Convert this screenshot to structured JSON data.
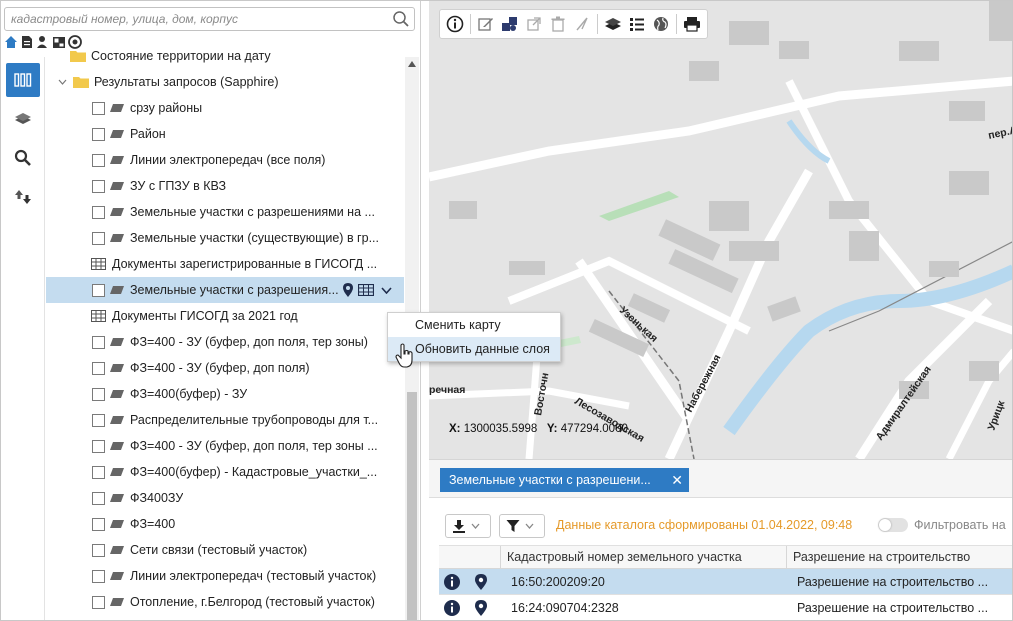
{
  "search": {
    "placeholder": "кадастровый номер, улица, дом, корпус"
  },
  "tree": {
    "partial_top": "Состояние территории на дату",
    "group": "Результаты запросов (Sapphire)",
    "items": [
      {
        "label": "срзу районы",
        "kind": "layer"
      },
      {
        "label": "Район",
        "kind": "layer"
      },
      {
        "label": "Линии электропередач (все поля)",
        "kind": "layer"
      },
      {
        "label": "ЗУ с ГПЗУ в КВЗ",
        "kind": "layer"
      },
      {
        "label": "Земельные участки с разрешениями на ...",
        "kind": "layer"
      },
      {
        "label": "Земельные участки (существующие) в гр...",
        "kind": "layer"
      },
      {
        "label": "Документы зарегистрированные в ГИСОГД ...",
        "kind": "table"
      },
      {
        "label": "Земельные участки с разрешения...",
        "kind": "layer",
        "selected": true
      },
      {
        "label": "Документы ГИСОГД за 2021 год",
        "kind": "table"
      },
      {
        "label": "ФЗ=400 - ЗУ (буфер, доп поля, тер зоны)",
        "kind": "layer"
      },
      {
        "label": "ФЗ=400 - ЗУ (буфер, доп поля)",
        "kind": "layer"
      },
      {
        "label": "ФЗ=400(буфер) - ЗУ",
        "kind": "layer"
      },
      {
        "label": "Распределительные трубопроводы для т...",
        "kind": "layer"
      },
      {
        "label": "ФЗ=400 - ЗУ (буфер, доп поля, тер зоны ...",
        "kind": "layer"
      },
      {
        "label": "ФЗ=400(буфер) - Кадастровые_участки_...",
        "kind": "layer"
      },
      {
        "label": "ФЗ400ЗУ",
        "kind": "layer"
      },
      {
        "label": "ФЗ=400",
        "kind": "layer"
      },
      {
        "label": "Сети связи (тестовый участок)",
        "kind": "layer"
      },
      {
        "label": "Линии электропередач (тестовый участок)",
        "kind": "layer"
      },
      {
        "label": "Отопление, г.Белгород (тестовый участок)",
        "kind": "layer"
      }
    ]
  },
  "context_menu": {
    "items": [
      "Сменить карту",
      "Обновить данные слоя"
    ]
  },
  "map": {
    "coords": {
      "x_label": "X:",
      "x_value": "1300035.5998",
      "y_label": "Y:",
      "y_value": "477294.0000"
    },
    "streets": [
      "пер.А",
      "Узенькая",
      "Набережная",
      "Лесозаводская",
      "Восточн",
      "речная",
      "Адмиралтейская",
      "Урицк"
    ]
  },
  "bottom": {
    "tab_label": "Земельные участки с разрешени...",
    "catalog_text": "Данные каталога сформированы 01.04.2022, 09:48",
    "filter_text": "Фильтровать на",
    "columns": [
      "Кадастровый номер земельного участка",
      "Разрешение на строительство"
    ],
    "rows": [
      {
        "cadastral": "16:50:200209:20",
        "permit": "Разрешение на строительство ...",
        "selected": true
      },
      {
        "cadastral": "16:24:090704:2328",
        "permit": "Разрешение на строительство ..."
      }
    ]
  },
  "colors": {
    "accent": "#2e7bc4",
    "selection": "#c4dcef",
    "catalog": "#e59a2a"
  }
}
